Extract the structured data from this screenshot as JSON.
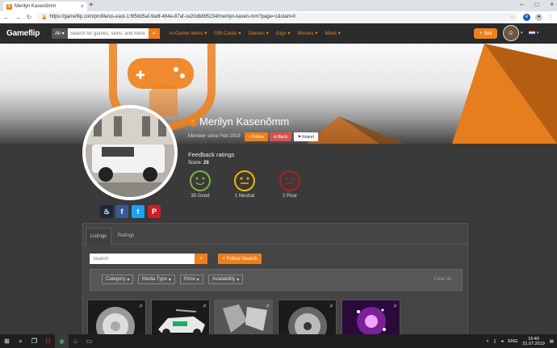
{
  "browser": {
    "tab_title": "Merilyn Kasenõmm",
    "url": "https://gameflip.com/profile/us-east-1:6f58d5af-9adf-464e-87af-ce20db895234/merilyn-kasen-mm?page=1&start=0"
  },
  "header": {
    "logo": "Gameflip",
    "search_scope": "All",
    "search_placeholder": "Search for games, skins, and more",
    "menu": [
      "In-Game Items",
      "Gift Cards",
      "Games",
      "Gigs",
      "Movies",
      "More"
    ],
    "sell_label": "Sell"
  },
  "profile": {
    "name": "Merilyn Kasenõmm",
    "member_since": "Member since Feb 2019",
    "follow_label": "Follow",
    "block_label": "Block",
    "report_label": "Report",
    "feedback_title": "Feedback ratings",
    "score_label": "Score:",
    "score_value": "28",
    "ratings": [
      {
        "label": "30 Good",
        "color": "#7cb342"
      },
      {
        "label": "1 Neutral",
        "color": "#f6b400"
      },
      {
        "label": "2 Poor",
        "color": "#b71c1c"
      }
    ]
  },
  "social": [
    {
      "name": "steam",
      "color": "#1b2838",
      "glyph": "♨"
    },
    {
      "name": "facebook",
      "color": "#3b5998",
      "glyph": "f"
    },
    {
      "name": "twitter",
      "color": "#1da1f2",
      "glyph": "t"
    },
    {
      "name": "pinterest",
      "color": "#cb2027",
      "glyph": "P"
    }
  ],
  "listings": {
    "tabs": [
      "Listings",
      "Ratings"
    ],
    "search_placeholder": "Search",
    "follow_search_label": "Follow Search",
    "filters": [
      "Category",
      "Media Type",
      "Price",
      "Availability"
    ],
    "clear_all": "Clear all"
  },
  "taskbar": {
    "lang": "ENG",
    "time": "16:40",
    "date": "21.07.2019"
  }
}
